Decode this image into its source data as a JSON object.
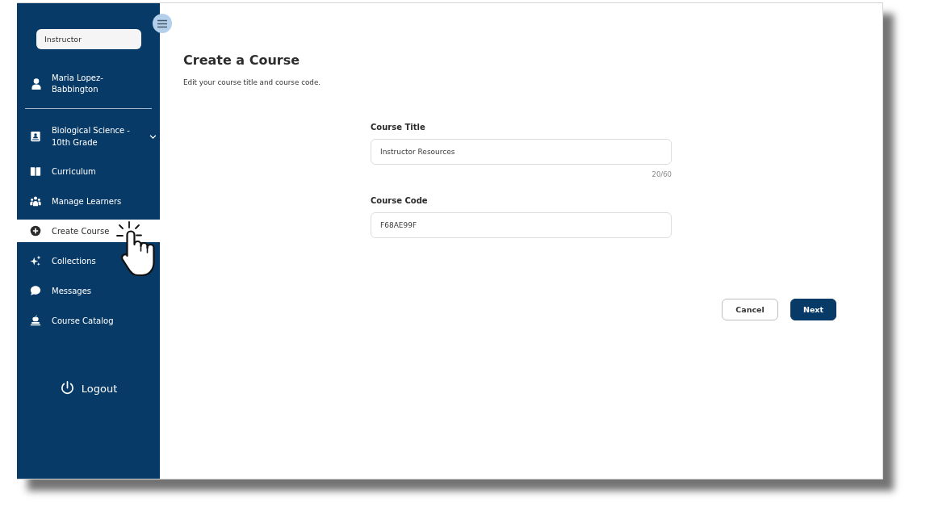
{
  "sidebar": {
    "role_field": {
      "value": "Instructor"
    },
    "user": {
      "name": "Maria Lopez-Babbington"
    },
    "nav_items": [
      {
        "label": "Biological Science - 10th Grade",
        "kind": "dropdown",
        "selected": false
      },
      {
        "label": "Curriculum",
        "kind": "link",
        "selected": false
      },
      {
        "label": "Manage Learners",
        "kind": "link",
        "selected": false
      },
      {
        "label": "Create Course",
        "kind": "link",
        "selected": true
      },
      {
        "label": "Collections",
        "kind": "link",
        "selected": false
      },
      {
        "label": "Messages",
        "kind": "link",
        "selected": false
      },
      {
        "label": "Course Catalog",
        "kind": "link",
        "selected": false
      }
    ],
    "logout": {
      "label": "Logout"
    }
  },
  "main": {
    "title": "Create a Course",
    "subtitle": "Edit your course title and course code.",
    "fields": [
      {
        "label": "Course Title",
        "value": "Instructor Resources",
        "counter": "20/60"
      },
      {
        "label": "Course Code",
        "value": "F68AE99F"
      }
    ],
    "buttons": [
      {
        "label": "Cancel",
        "kind": "secondary"
      },
      {
        "label": "Next",
        "kind": "primary"
      }
    ]
  }
}
